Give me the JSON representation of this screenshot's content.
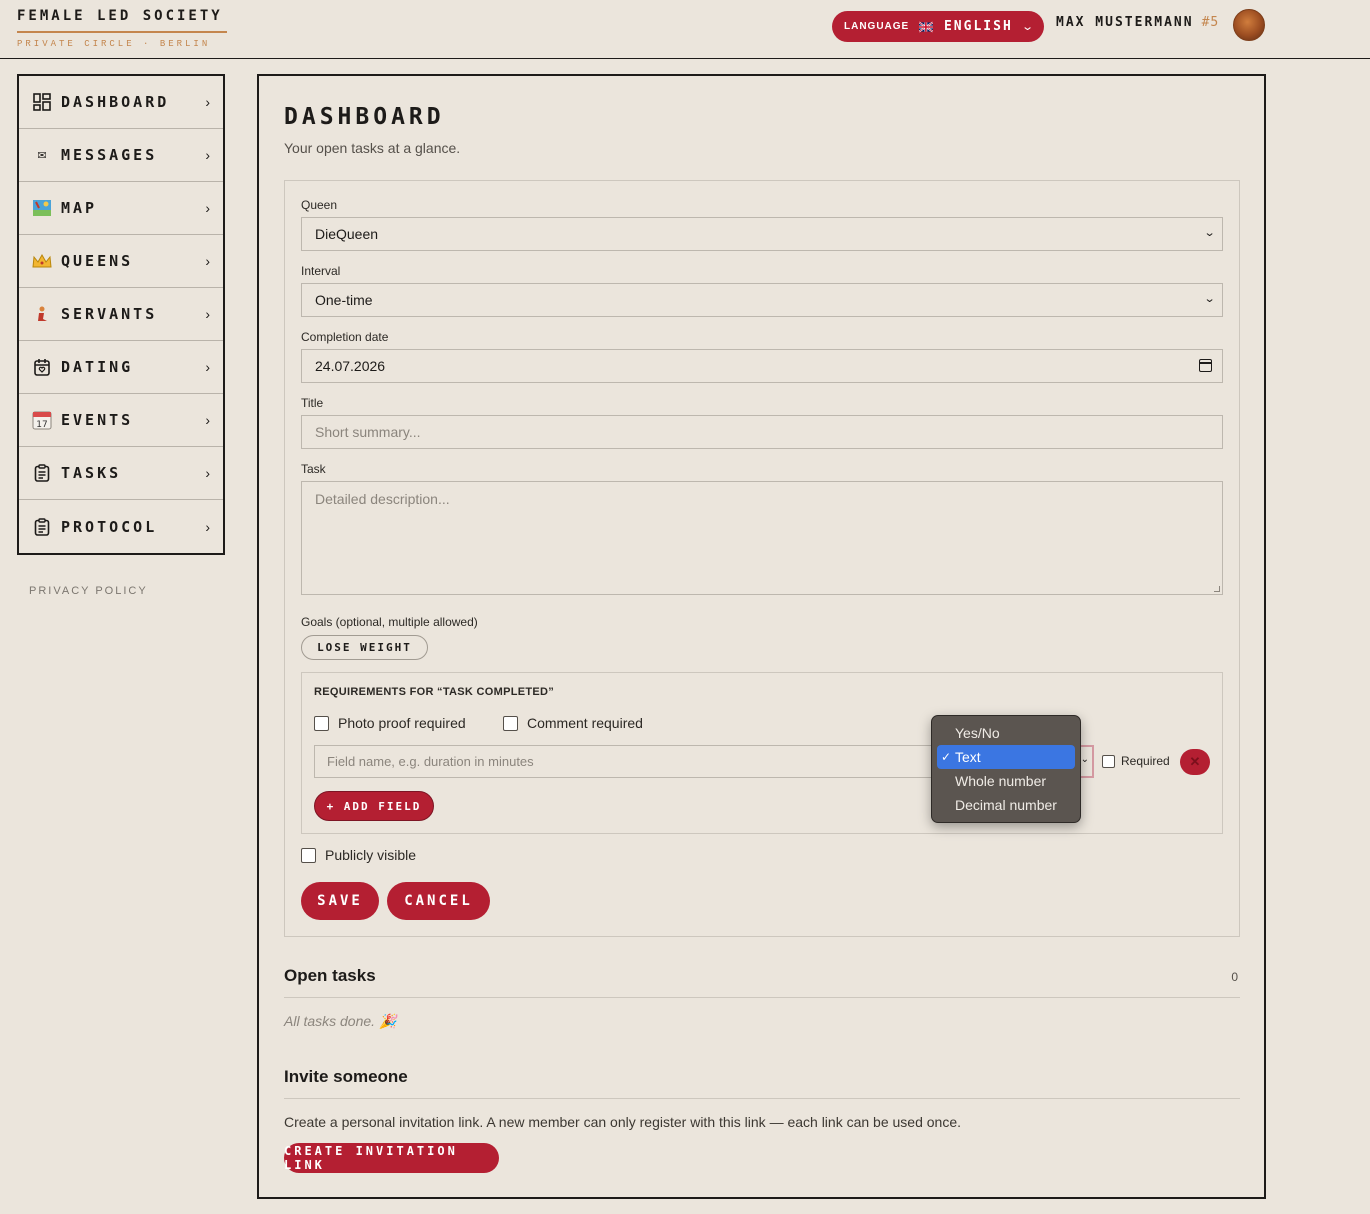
{
  "brand": {
    "title": "FEMALE LED SOCIETY",
    "subtitle": "PRIVATE CIRCLE · BERLIN"
  },
  "header": {
    "language_label": "LANGUAGE",
    "language_value": "ENGLISH",
    "user_name": "MAX MUSTERMANN",
    "user_number": "#5"
  },
  "sidebar": {
    "items": [
      {
        "label": "DASHBOARD",
        "icon": "dashboard-icon"
      },
      {
        "label": "MESSAGES",
        "icon": "envelope-icon"
      },
      {
        "label": "MAP",
        "icon": "map-icon"
      },
      {
        "label": "QUEENS",
        "icon": "crown-icon"
      },
      {
        "label": "SERVANTS",
        "icon": "servant-icon"
      },
      {
        "label": "DATING",
        "icon": "calendar-heart-icon"
      },
      {
        "label": "EVENTS",
        "icon": "calendar-17-icon"
      },
      {
        "label": "TASKS",
        "icon": "clipboard-icon"
      },
      {
        "label": "PROTOCOL",
        "icon": "clipboard-icon"
      }
    ],
    "privacy": "PRIVACY POLICY"
  },
  "main": {
    "title": "DASHBOARD",
    "subtitle": "Your open tasks at a glance.",
    "form": {
      "queen_label": "Queen",
      "queen_value": "DieQueen",
      "interval_label": "Interval",
      "interval_value": "One-time",
      "date_label": "Completion date",
      "date_value": "24.07.2026",
      "title_label": "Title",
      "title_placeholder": "Short summary...",
      "task_label": "Task",
      "task_placeholder": "Detailed description...",
      "goals_label": "Goals (optional, multiple allowed)",
      "goal_chip": "LOSE WEIGHT",
      "requirements": {
        "title": "REQUIREMENTS FOR “TASK COMPLETED”",
        "photo_proof": "Photo proof required",
        "comment": "Comment required",
        "field_placeholder": "Field name, e.g. duration in minutes",
        "required_label": "Required",
        "add_field": "+ ADD FIELD"
      },
      "public_label": "Publicly visible",
      "save": "SAVE",
      "cancel": "CANCEL"
    },
    "open_tasks": {
      "title": "Open tasks",
      "count": "0",
      "empty": "All tasks done. 🎉"
    },
    "invite": {
      "title": "Invite someone",
      "text": "Create a personal invitation link. A new member can only register with this link — each link can be used once.",
      "button": "CREATE INVITATION LINK"
    }
  },
  "dropdown": {
    "options": [
      "Yes/No",
      "Text",
      "Whole number",
      "Decimal number"
    ],
    "selected": "Text",
    "check": "✓"
  },
  "colors": {
    "accent": "#b41f32",
    "background": "#ebe5dc",
    "gold": "#c4864e",
    "dropdown_bg": "#5b5550",
    "selection": "#3b76e2"
  }
}
